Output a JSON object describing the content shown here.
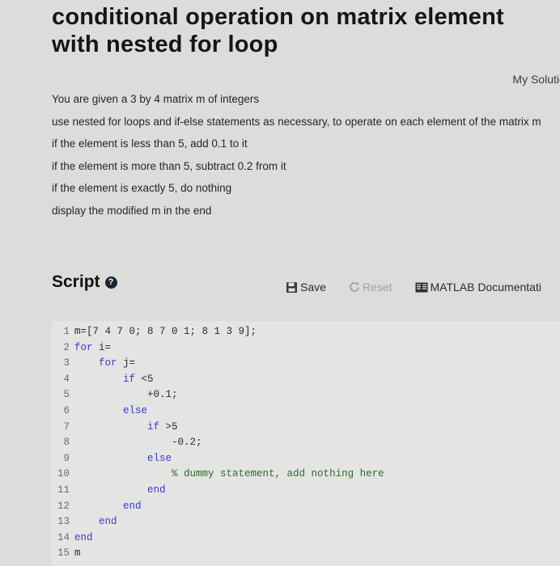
{
  "page": {
    "title": "conditional operation on matrix element with nested for loop",
    "my_solutions": "My Solutic"
  },
  "problem": {
    "lines": [
      "You are given a 3 by 4 matrix m of integers",
      "use nested for loops and if-else statements as necessary, to operate on each element of the matrix m",
      "if the element is less than 5, add 0.1 to it",
      "if the element is more than 5, subtract 0.2 from it",
      "if the element is exactly 5, do nothing",
      "display the modified m in the end"
    ]
  },
  "script": {
    "title": "Script",
    "help_icon": "question-circle-icon",
    "toolbar": {
      "save_label": "Save",
      "reset_label": "Reset",
      "doc_label": "MATLAB Documentati"
    },
    "code": [
      {
        "num": "1",
        "indent": "",
        "kw": "",
        "text": "m=[7 4 7 0; 8 7 0 1; 8 1 3 9];",
        "type": "plain"
      },
      {
        "num": "2",
        "indent": "",
        "kw": "for",
        "text": " i=",
        "type": "kw"
      },
      {
        "num": "3",
        "indent": "    ",
        "kw": "for",
        "text": " j=",
        "type": "kw"
      },
      {
        "num": "4",
        "indent": "        ",
        "kw": "if",
        "text": " <5",
        "type": "kw"
      },
      {
        "num": "5",
        "indent": "            ",
        "kw": "",
        "text": "+0.1;",
        "type": "plain"
      },
      {
        "num": "6",
        "indent": "        ",
        "kw": "else",
        "text": "",
        "type": "kw"
      },
      {
        "num": "7",
        "indent": "            ",
        "kw": "if",
        "text": " >5",
        "type": "kw"
      },
      {
        "num": "8",
        "indent": "                ",
        "kw": "",
        "text": "-0.2;",
        "type": "plain"
      },
      {
        "num": "9",
        "indent": "            ",
        "kw": "else",
        "text": "",
        "type": "kw"
      },
      {
        "num": "10",
        "indent": "                ",
        "kw": "",
        "text": "% dummy statement, add nothing here",
        "type": "comment"
      },
      {
        "num": "11",
        "indent": "            ",
        "kw": "end",
        "text": "",
        "type": "kw"
      },
      {
        "num": "12",
        "indent": "        ",
        "kw": "end",
        "text": "",
        "type": "kw"
      },
      {
        "num": "13",
        "indent": "    ",
        "kw": "end",
        "text": "",
        "type": "kw"
      },
      {
        "num": "14",
        "indent": "",
        "kw": "end",
        "text": "",
        "type": "kw"
      },
      {
        "num": "15",
        "indent": "",
        "kw": "",
        "text": "m",
        "type": "plain"
      }
    ]
  },
  "colors": {
    "keyword": "#3a3ad0",
    "comment": "#2c6a2c",
    "reset_disabled": "#9aa3ad"
  }
}
